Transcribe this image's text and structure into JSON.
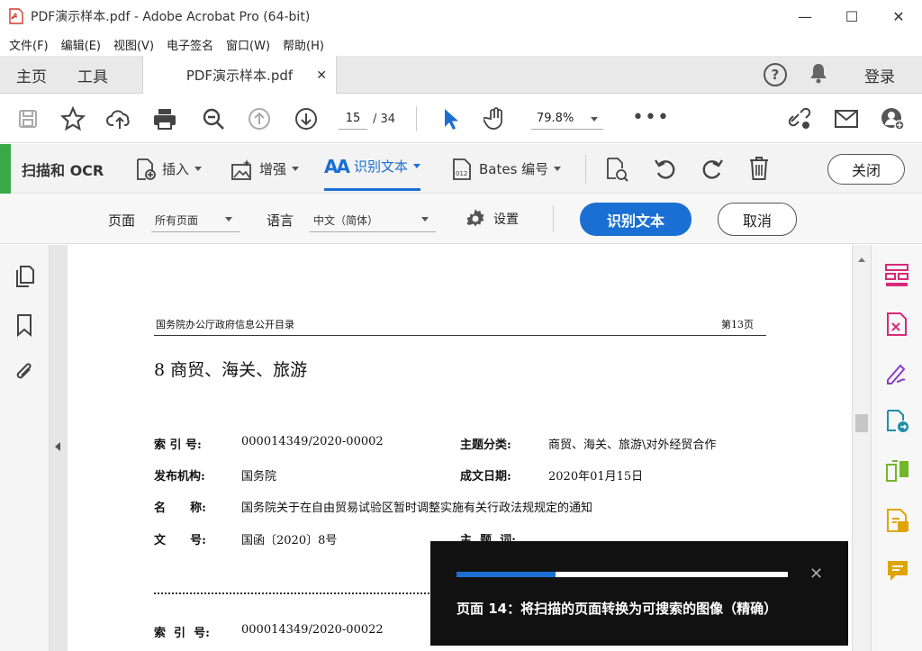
{
  "window": {
    "title": "PDF演示样本.pdf - Adobe Acrobat Pro (64-bit)"
  },
  "menu": [
    "文件(F)",
    "编辑(E)",
    "视图(V)",
    "电子签名",
    "窗口(W)",
    "帮助(H)"
  ],
  "tabs": {
    "home": "主页",
    "tools": "工具",
    "doc": "PDF演示样本.pdf",
    "login": "登录"
  },
  "toolbar": {
    "page_current": "15",
    "page_total": "/ 34",
    "zoom": "79.8%"
  },
  "ocr": {
    "title": "扫描和 OCR",
    "insert": "插入",
    "enhance": "增强",
    "recognize": "识别文本",
    "bates": "Bates 编号",
    "close": "关闭"
  },
  "options": {
    "page_label": "页面",
    "page_value": "所有页面",
    "lang_label": "语言",
    "lang_value": "中文（简体）",
    "settings": "设置",
    "recognize_btn": "识别文本",
    "cancel_btn": "取消"
  },
  "doc": {
    "header_left": "国务院办公厅政府信息公开目录",
    "header_right": "第13页",
    "heading": "8  商贸、海关、旅游",
    "rows": [
      {
        "k1": "索  引  号:",
        "v1": "000014349/2020-00002",
        "k2": "主题分类:",
        "v2": "商贸、海关、旅游\\对外经贸合作"
      },
      {
        "k1": "发布机构:",
        "v1": "国务院",
        "k2": "成文日期:",
        "v2": "2020年01月15日"
      },
      {
        "k1": "名      称:",
        "v1": "国务院关于在自由贸易试验区暂时调整实施有关行政法规规定的通知",
        "k2": "",
        "v2": ""
      },
      {
        "k1": "文      号:",
        "v1": "国函〔2020〕8号",
        "k2": "主  题  词:",
        "v2": ""
      }
    ],
    "row_last": {
      "k1": "索  引  号:",
      "v1": "000014349/2020-00022"
    }
  },
  "toast": {
    "message": "页面 14：将扫描的页面转换为可搜索的图像（精确）",
    "progress": 0.3
  },
  "colors": {
    "accent_blue": "#1a6fd2",
    "ocr_green": "#39a84a",
    "rail_pink": "#d8297a",
    "rail_purple": "#8b3ec7",
    "rail_teal": "#1d8fa8",
    "rail_lime": "#73b62a",
    "rail_yellow": "#e0a400"
  }
}
